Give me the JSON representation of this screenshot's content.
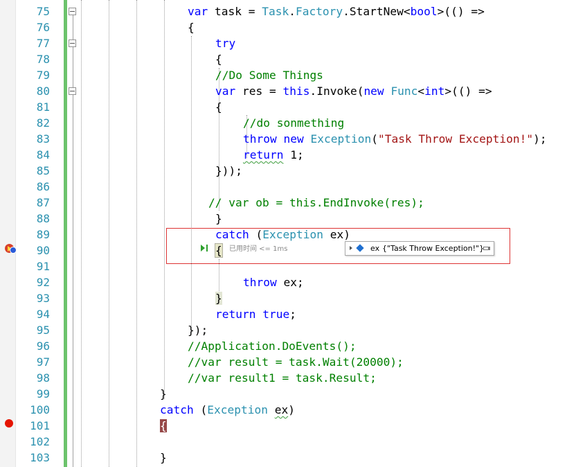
{
  "editor": {
    "line_numbers": [
      "75",
      "76",
      "77",
      "78",
      "79",
      "80",
      "81",
      "82",
      "83",
      "84",
      "85",
      "86",
      "87",
      "88",
      "89",
      "90",
      "91",
      "92",
      "93",
      "94",
      "95",
      "96",
      "97",
      "98",
      "99",
      "100",
      "101",
      "102",
      "103"
    ],
    "line75": {
      "p1": "var",
      "p2": " task = ",
      "p3": "Task",
      "p4": ".",
      "p5": "Factory",
      "p6": ".StartNew<",
      "p7": "bool",
      "p8": ">(() =>"
    },
    "line76": {
      "p1": "{"
    },
    "line77": {
      "p1": "try"
    },
    "line78": {
      "p1": "{"
    },
    "line79": {
      "p1": "//Do Some Things"
    },
    "line80": {
      "p1": "var",
      "p2": " res = ",
      "p3": "this",
      "p4": ".Invoke(",
      "p5": "new",
      "p6": " ",
      "p7": "Func",
      "p8": "<",
      "p9": "int",
      "p10": ">(() =>"
    },
    "line81": {
      "p1": "{"
    },
    "line82": {
      "p1": "//do sonmething"
    },
    "line83": {
      "p1": "throw",
      "p2": " ",
      "p3": "new",
      "p4": " ",
      "p5": "Exception",
      "p6": "(",
      "p7": "\"Task Throw Exception!\"",
      "p8": ");"
    },
    "line84": {
      "p1": "return",
      "p2": " 1;"
    },
    "line85": {
      "p1": "}));"
    },
    "line87": {
      "p1": "// var ob = this.EndInvoke(res);"
    },
    "line88": {
      "p1": "}"
    },
    "line89": {
      "p1": "catch",
      "p2": " (",
      "p3": "Exception",
      "p4": " ex)"
    },
    "line90": {
      "p1": "{"
    },
    "line92": {
      "p1": "throw",
      "p2": " ex;"
    },
    "line93": {
      "p1": "}"
    },
    "line94": {
      "p1": "return",
      "p2": " ",
      "p3": "true",
      "p4": ";"
    },
    "line95": {
      "p1": "});"
    },
    "line96": {
      "p1": "//Application.DoEvents();"
    },
    "line97": {
      "p1": "//var result = task.Wait(20000);"
    },
    "line98": {
      "p1": "//var result1 = task.Result;"
    },
    "line99": {
      "p1": "}"
    },
    "line100": {
      "p1": "catch",
      "p2": " (",
      "p3": "Exception",
      "p4": " ",
      "p5": "ex",
      "p6": ")"
    },
    "line101": {
      "p1": "{"
    },
    "line103": {
      "p1": "}"
    }
  },
  "perf_tip": {
    "text": "已用时间 <= 1ms"
  },
  "datatip": {
    "name": "ex",
    "value": "{\"Task Throw Exception!\"}"
  },
  "colors": {
    "keyword": "#0000ff",
    "type": "#2b91af",
    "string": "#a31515",
    "comment": "#008000",
    "line_number": "#2b91af",
    "change_bar": "#6cc36c",
    "breakpoint": "#e51400",
    "highlight_box": "#dd3333"
  },
  "icons": {
    "breakpoint": "breakpoint-icon",
    "current_statement": "current-statement-breakpoint-icon",
    "exec_pointer": "run-to-click-icon",
    "datatip_pin": "pin-icon"
  }
}
